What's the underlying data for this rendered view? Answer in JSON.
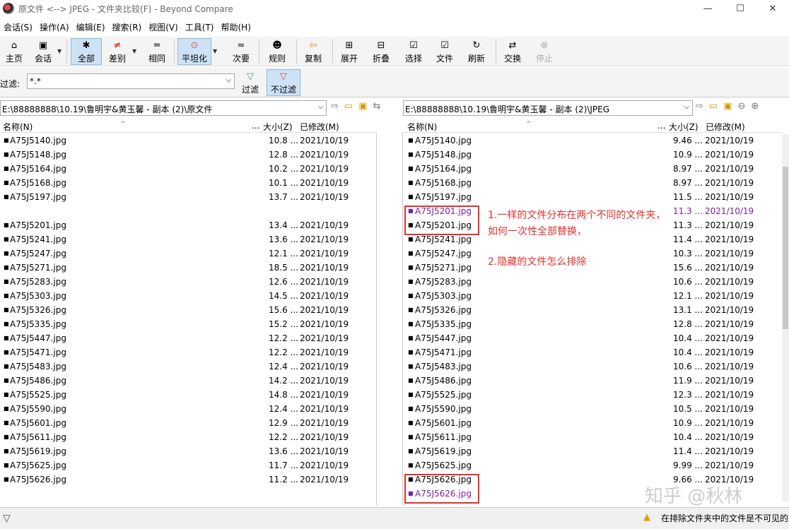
{
  "window": {
    "title": "原文件 <--> JPEG - 文件夹比较(F) - Beyond Compare"
  },
  "window_buttons": [
    "—",
    "☐",
    "✕"
  ],
  "menu": [
    "会话(S)",
    "操作(A)",
    "编辑(E)",
    "搜索(R)",
    "视图(V)",
    "工具(T)",
    "帮助(H)"
  ],
  "toolbar": [
    {
      "label": "主页",
      "icon": "⌂"
    },
    {
      "label": "会话",
      "icon": "▣"
    },
    {
      "label": "全部",
      "icon": "✱"
    },
    {
      "label": "差别",
      "icon": "≠"
    },
    {
      "label": "相同",
      "icon": "="
    },
    {
      "label": "平坦化",
      "icon": "⊙"
    },
    {
      "label": "次要",
      "icon": "≈"
    },
    {
      "label": "规则",
      "icon": "☻"
    },
    {
      "label": "复制",
      "icon": "⇦"
    },
    {
      "label": "展开",
      "icon": "⊞"
    },
    {
      "label": "折叠",
      "icon": "⊟"
    },
    {
      "label": "选择",
      "icon": "☑"
    },
    {
      "label": "文件",
      "icon": "☑"
    },
    {
      "label": "刷新",
      "icon": "↻"
    },
    {
      "label": "交换",
      "icon": "⇄"
    },
    {
      "label": "停止",
      "icon": "⊗"
    }
  ],
  "filter": {
    "label": "过滤:",
    "value": "*.*",
    "filter_btn": "过滤",
    "nofilter_btn": "不过滤"
  },
  "left_path": "E:\\88888888\\10.19\\鲁明宇&黄玉馨 - 副本 (2)\\原文件",
  "right_path": "E:\\88888888\\10.19\\鲁明宇&黄玉馨 - 副本 (2)\\JPEG",
  "columns": {
    "name": "名称(N)",
    "size": "大小(Z)",
    "modified": "已修改(M)",
    "size_prefix": "..."
  },
  "left_rows": [
    {
      "name": "A75J5140.jpg",
      "size": "10.8 ...",
      "date": "2021/10/19"
    },
    {
      "name": "A75J5148.jpg",
      "size": "12.8 ...",
      "date": "2021/10/19"
    },
    {
      "name": "A75J5164.jpg",
      "size": "10.2 ...",
      "date": "2021/10/19"
    },
    {
      "name": "A75J5168.jpg",
      "size": "10.1 ...",
      "date": "2021/10/19"
    },
    {
      "name": "A75J5197.jpg",
      "size": "13.7 ...",
      "date": "2021/10/19"
    },
    {
      "name": "",
      "size": "",
      "date": ""
    },
    {
      "name": "A75J5201.jpg",
      "size": "13.4 ...",
      "date": "2021/10/19"
    },
    {
      "name": "A75J5241.jpg",
      "size": "13.6 ...",
      "date": "2021/10/19"
    },
    {
      "name": "A75J5247.jpg",
      "size": "12.1 ...",
      "date": "2021/10/19"
    },
    {
      "name": "A75J5271.jpg",
      "size": "18.5 ...",
      "date": "2021/10/19"
    },
    {
      "name": "A75J5283.jpg",
      "size": "12.6 ...",
      "date": "2021/10/19"
    },
    {
      "name": "A75J5303.jpg",
      "size": "14.5 ...",
      "date": "2021/10/19"
    },
    {
      "name": "A75J5326.jpg",
      "size": "15.6 ...",
      "date": "2021/10/19"
    },
    {
      "name": "A75J5335.jpg",
      "size": "15.2 ...",
      "date": "2021/10/19"
    },
    {
      "name": "A75J5447.jpg",
      "size": "12.2 ...",
      "date": "2021/10/19"
    },
    {
      "name": "A75J5471.jpg",
      "size": "12.2 ...",
      "date": "2021/10/19"
    },
    {
      "name": "A75J5483.jpg",
      "size": "12.4 ...",
      "date": "2021/10/19"
    },
    {
      "name": "A75J5486.jpg",
      "size": "14.2 ...",
      "date": "2021/10/19"
    },
    {
      "name": "A75J5525.jpg",
      "size": "14.8 ...",
      "date": "2021/10/19"
    },
    {
      "name": "A75J5590.jpg",
      "size": "12.4 ...",
      "date": "2021/10/19"
    },
    {
      "name": "A75J5601.jpg",
      "size": "12.9 ...",
      "date": "2021/10/19"
    },
    {
      "name": "A75J5611.jpg",
      "size": "12.2 ...",
      "date": "2021/10/19"
    },
    {
      "name": "A75J5619.jpg",
      "size": "13.6 ...",
      "date": "2021/10/19"
    },
    {
      "name": "A75J5625.jpg",
      "size": "11.7 ...",
      "date": "2021/10/19"
    },
    {
      "name": "A75J5626.jpg",
      "size": "11.2 ...",
      "date": "2021/10/19"
    }
  ],
  "right_rows": [
    {
      "name": "A75J5140.jpg",
      "size": "9.46 ...",
      "date": "2021/10/19",
      "purple": false
    },
    {
      "name": "A75J5148.jpg",
      "size": "10.9 ...",
      "date": "2021/10/19",
      "purple": false
    },
    {
      "name": "A75J5164.jpg",
      "size": "8.97 ...",
      "date": "2021/10/19",
      "purple": false
    },
    {
      "name": "A75J5168.jpg",
      "size": "8.97 ...",
      "date": "2021/10/19",
      "purple": false
    },
    {
      "name": "A75J5197.jpg",
      "size": "11.5 ...",
      "date": "2021/10/19",
      "purple": false
    },
    {
      "name": "A75J5201.jpg",
      "size": "11.3 ...",
      "date": "2021/10/19",
      "purple": true
    },
    {
      "name": "A75J5201.jpg",
      "size": "11.3 ...",
      "date": "2021/10/19",
      "purple": false
    },
    {
      "name": "A75J5241.jpg",
      "size": "11.4 ...",
      "date": "2021/10/19",
      "purple": false
    },
    {
      "name": "A75J5247.jpg",
      "size": "10.3 ...",
      "date": "2021/10/19",
      "purple": false
    },
    {
      "name": "A75J5271.jpg",
      "size": "15.6 ...",
      "date": "2021/10/19",
      "purple": false
    },
    {
      "name": "A75J5283.jpg",
      "size": "10.6 ...",
      "date": "2021/10/19",
      "purple": false
    },
    {
      "name": "A75J5303.jpg",
      "size": "12.1 ...",
      "date": "2021/10/19",
      "purple": false
    },
    {
      "name": "A75J5326.jpg",
      "size": "13.1 ...",
      "date": "2021/10/19",
      "purple": false
    },
    {
      "name": "A75J5335.jpg",
      "size": "12.8 ...",
      "date": "2021/10/19",
      "purple": false
    },
    {
      "name": "A75J5447.jpg",
      "size": "10.4 ...",
      "date": "2021/10/19",
      "purple": false
    },
    {
      "name": "A75J5471.jpg",
      "size": "10.4 ...",
      "date": "2021/10/19",
      "purple": false
    },
    {
      "name": "A75J5483.jpg",
      "size": "10.6 ...",
      "date": "2021/10/19",
      "purple": false
    },
    {
      "name": "A75J5486.jpg",
      "size": "11.9 ...",
      "date": "2021/10/19",
      "purple": false
    },
    {
      "name": "A75J5525.jpg",
      "size": "12.3 ...",
      "date": "2021/10/19",
      "purple": false
    },
    {
      "name": "A75J5590.jpg",
      "size": "10.5 ...",
      "date": "2021/10/19",
      "purple": false
    },
    {
      "name": "A75J5601.jpg",
      "size": "10.9 ...",
      "date": "2021/10/19",
      "purple": false
    },
    {
      "name": "A75J5611.jpg",
      "size": "10.4 ...",
      "date": "2021/10/19",
      "purple": false
    },
    {
      "name": "A75J5619.jpg",
      "size": "11.4 ...",
      "date": "2021/10/19",
      "purple": false
    },
    {
      "name": "A75J5625.jpg",
      "size": "9.99 ...",
      "date": "2021/10/19",
      "purple": false
    },
    {
      "name": "A75J5626.jpg",
      "size": "9.66 ...",
      "date": "2021/10/19",
      "purple": false
    },
    {
      "name": "A75J5626.jpg",
      "size": "",
      "date": "",
      "purple": true
    }
  ],
  "annotations": {
    "line1": "1.一样的文件分布在两个不同的文件夹，",
    "line2": "如何一次性全部替换，",
    "line3": "2.隐藏的文件怎么排除"
  },
  "status": {
    "message": "在排除文件夹中的文件是不可见的"
  },
  "watermark": "知乎 @秋林",
  "colors": {
    "annotation": "#e03030",
    "purple": "#7b1fa2",
    "active_button": "#cde3f5"
  }
}
